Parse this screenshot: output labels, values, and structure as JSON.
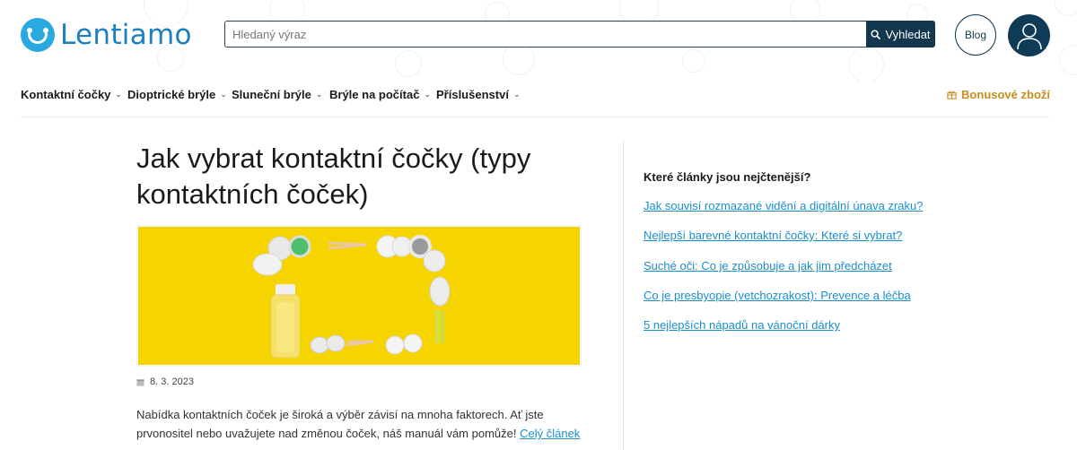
{
  "brand": {
    "name": "Lentiamo"
  },
  "search": {
    "placeholder": "Hledaný výraz",
    "button_label": "Vyhledat"
  },
  "header": {
    "blog_label": "Blog"
  },
  "nav": {
    "items": [
      {
        "label": "Kontaktní čočky"
      },
      {
        "label": "Dioptrické brýle"
      },
      {
        "label": "Sluneční brýle"
      },
      {
        "label": "Brýle na počítač"
      },
      {
        "label": "Příslušenství"
      }
    ],
    "bonus_label": "Bonusové zboží"
  },
  "article": {
    "title": "Jak vybrat kontaktní čočky (typy kontaktních čoček)",
    "date": "8. 3. 2023",
    "excerpt": "Nabídka kontaktních čoček je široká a výběr závisí na mnoha faktorech. Ať jste prvonositel nebo uvažujete nad změnou čoček, náš manuál vám pomůže!",
    "read_more": "Celý článek"
  },
  "sidebar": {
    "title": "Které články jsou nejčtenější?",
    "links": [
      "Jak souvisí rozmazané vidění a digitální únava zraku?",
      "Nejlepší barevné kontaktní čočky: Které si vybrat?",
      "Suché oči: Co je způsobuje a jak jim předcházet",
      "Co je presbyopie (vetchozrakost): Prevence a léčba",
      "5 nejlepších nápadů na vánoční dárky"
    ]
  },
  "colors": {
    "brand_blue": "#2aa8e0",
    "navy": "#12384f",
    "link": "#1b8ec9",
    "bonus": "#c88d1a",
    "hero_background": "#f5d400"
  }
}
